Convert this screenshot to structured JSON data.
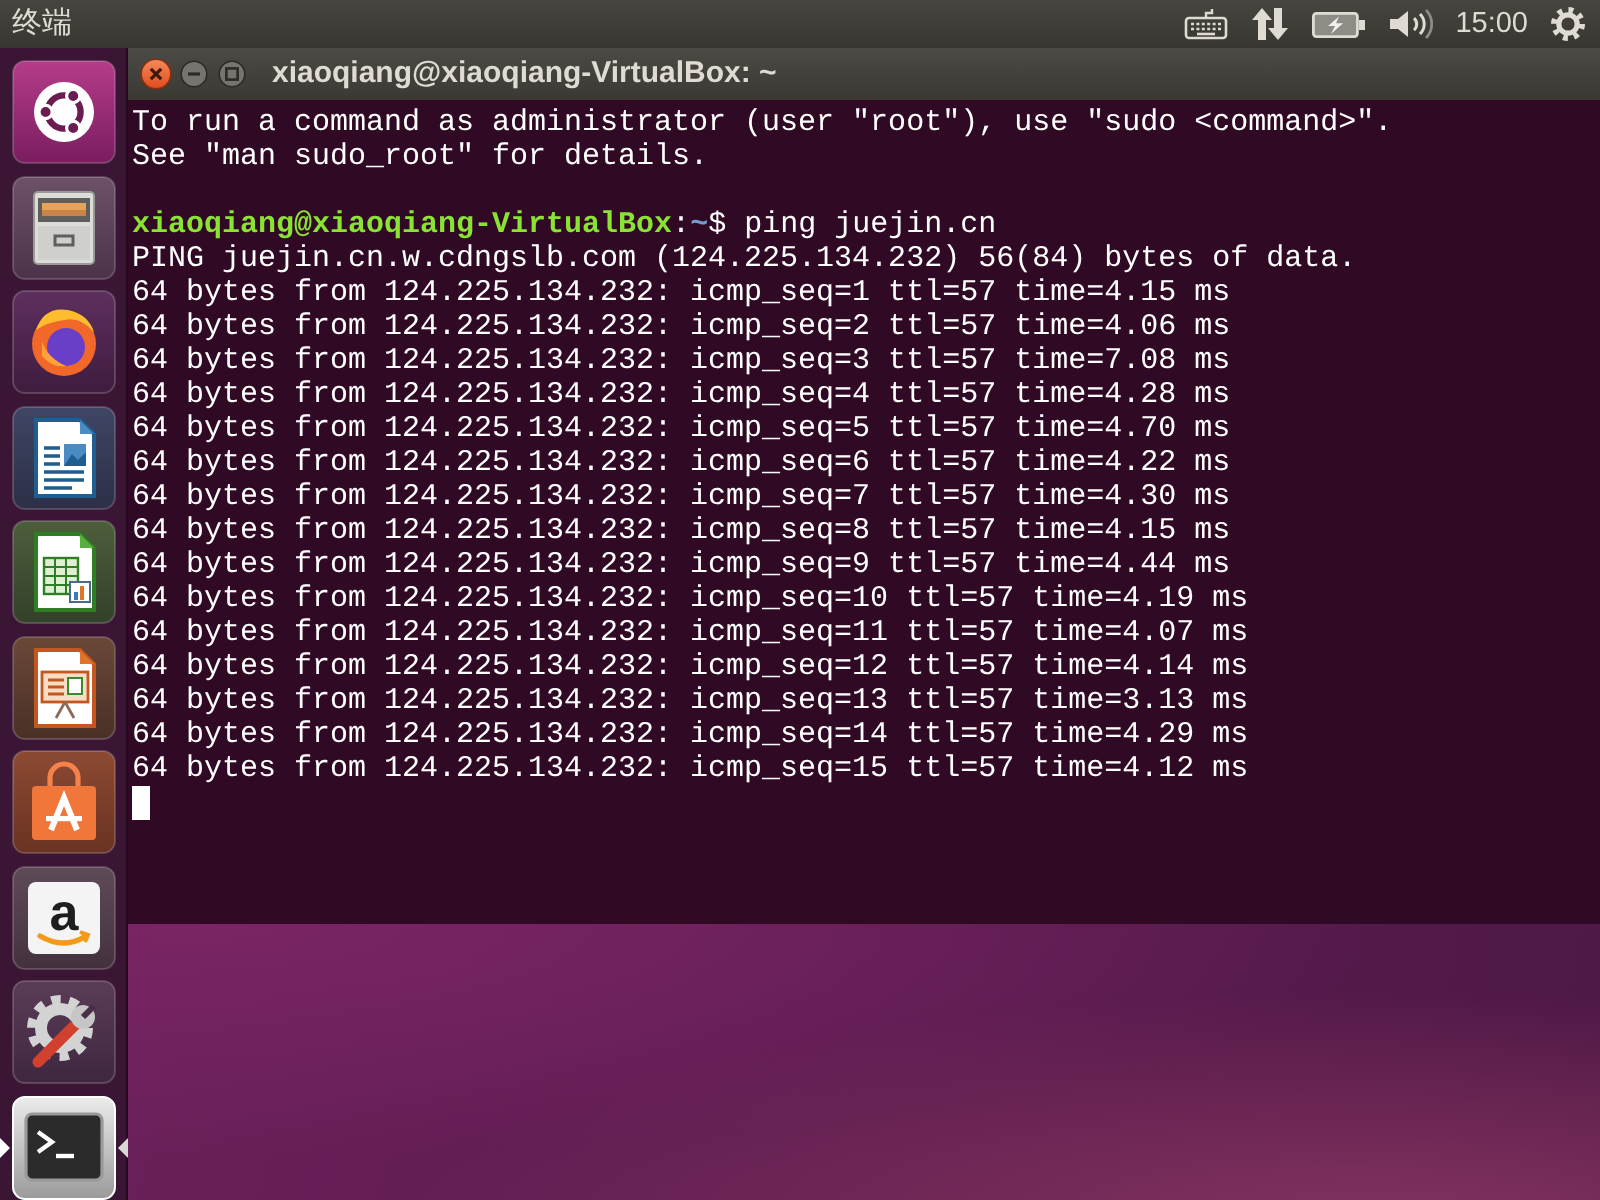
{
  "top_panel": {
    "app_title": "终端",
    "clock": "15:00"
  },
  "launcher": {
    "items": [
      {
        "kind": "dash",
        "selected": false
      },
      {
        "kind": "files",
        "selected": false
      },
      {
        "kind": "browser",
        "selected": false
      },
      {
        "kind": "writer",
        "selected": false
      },
      {
        "kind": "calc",
        "selected": false
      },
      {
        "kind": "impress",
        "selected": false
      },
      {
        "kind": "store",
        "selected": false
      },
      {
        "kind": "shop",
        "glyph": "a",
        "selected": false
      },
      {
        "kind": "settings",
        "selected": false
      },
      {
        "kind": "terminal",
        "selected": true
      }
    ]
  },
  "terminal": {
    "title": "xiaoqiang@xiaoqiang-VirtualBox: ~",
    "cursor": true,
    "lines": [
      {
        "kind": "text",
        "text": "To run a command as administrator (user \"root\"), use \"sudo <command>\"."
      },
      {
        "kind": "text",
        "text": "See \"man sudo_root\" for details."
      },
      {
        "kind": "blank"
      },
      {
        "kind": "prompt",
        "user_host": "xiaoqiang@xiaoqiang-VirtualBox",
        "separator": ":",
        "path": "~",
        "symbol": "$",
        "command": "ping juejin.cn"
      },
      {
        "kind": "text",
        "text": "PING juejin.cn.w.cdngslb.com (124.225.134.232) 56(84) bytes of data."
      },
      {
        "kind": "text",
        "text": "64 bytes from 124.225.134.232: icmp_seq=1 ttl=57 time=4.15 ms"
      },
      {
        "kind": "text",
        "text": "64 bytes from 124.225.134.232: icmp_seq=2 ttl=57 time=4.06 ms"
      },
      {
        "kind": "text",
        "text": "64 bytes from 124.225.134.232: icmp_seq=3 ttl=57 time=7.08 ms"
      },
      {
        "kind": "text",
        "text": "64 bytes from 124.225.134.232: icmp_seq=4 ttl=57 time=4.28 ms"
      },
      {
        "kind": "text",
        "text": "64 bytes from 124.225.134.232: icmp_seq=5 ttl=57 time=4.70 ms"
      },
      {
        "kind": "text",
        "text": "64 bytes from 124.225.134.232: icmp_seq=6 ttl=57 time=4.22 ms"
      },
      {
        "kind": "text",
        "text": "64 bytes from 124.225.134.232: icmp_seq=7 ttl=57 time=4.30 ms"
      },
      {
        "kind": "text",
        "text": "64 bytes from 124.225.134.232: icmp_seq=8 ttl=57 time=4.15 ms"
      },
      {
        "kind": "text",
        "text": "64 bytes from 124.225.134.232: icmp_seq=9 ttl=57 time=4.44 ms"
      },
      {
        "kind": "text",
        "text": "64 bytes from 124.225.134.232: icmp_seq=10 ttl=57 time=4.19 ms"
      },
      {
        "kind": "text",
        "text": "64 bytes from 124.225.134.232: icmp_seq=11 ttl=57 time=4.07 ms"
      },
      {
        "kind": "text",
        "text": "64 bytes from 124.225.134.232: icmp_seq=12 ttl=57 time=4.14 ms"
      },
      {
        "kind": "text",
        "text": "64 bytes from 124.225.134.232: icmp_seq=13 ttl=57 time=3.13 ms"
      },
      {
        "kind": "text",
        "text": "64 bytes from 124.225.134.232: icmp_seq=14 ttl=57 time=4.29 ms"
      },
      {
        "kind": "text",
        "text": "64 bytes from 124.225.134.232: icmp_seq=15 ttl=57 time=4.12 ms"
      }
    ]
  }
}
